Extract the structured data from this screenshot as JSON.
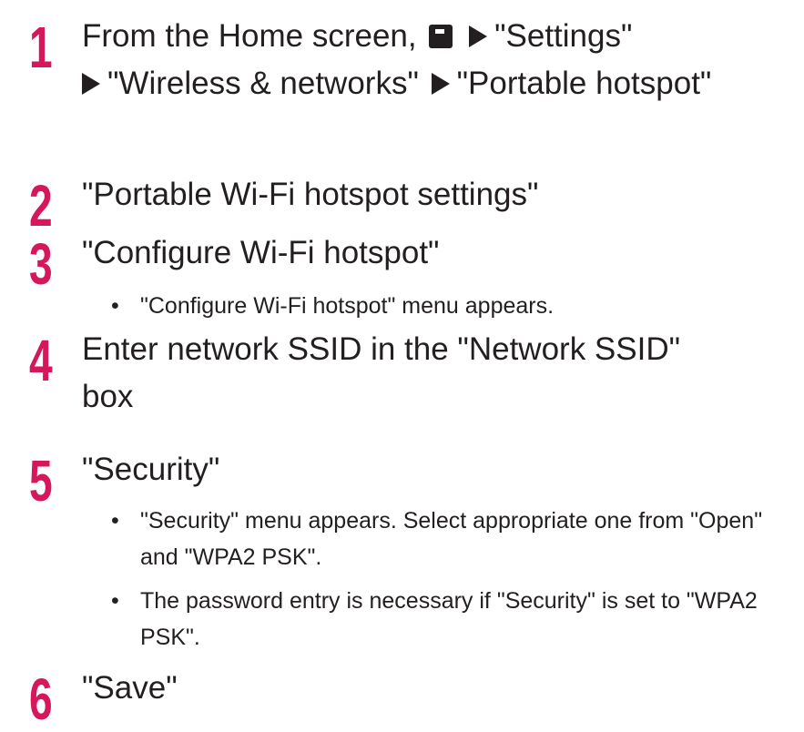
{
  "steps": [
    {
      "number": "1",
      "text_before_icon": "From the Home screen,",
      "icon": "menu-key-icon",
      "path": [
        "\"Settings\"",
        "\"Wireless & networks\"",
        "\"Portable hotspot\""
      ]
    },
    {
      "number": "2",
      "text": "\"Portable Wi-Fi hotspot settings\""
    },
    {
      "number": "3",
      "text": "\"Configure Wi-Fi hotspot\"",
      "notes": [
        "\"Configure Wi-Fi hotspot\" menu appears."
      ]
    },
    {
      "number": "4",
      "text": "Enter network SSID in the \"Network SSID\" box"
    },
    {
      "number": "5",
      "text": "\"Security\"",
      "notes": [
        "\"Security\" menu appears. Select appropriate one from \"Open\" and \"WPA2 PSK\".",
        "The password entry is necessary if \"Security\" is set to \"WPA2 PSK\"."
      ]
    },
    {
      "number": "6",
      "text": "\"Save\""
    }
  ],
  "bullet_glyph": "•",
  "colors": {
    "step_number": "#d6175b",
    "text": "#231f20"
  }
}
